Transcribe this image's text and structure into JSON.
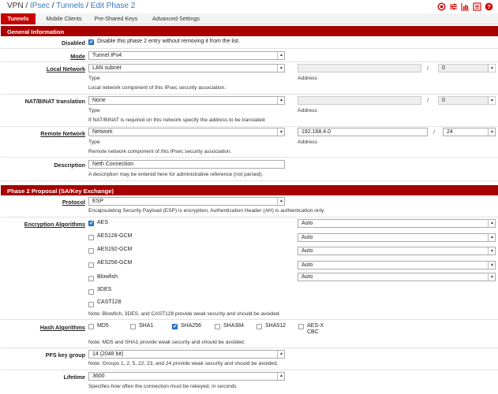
{
  "breadcrumb": {
    "vpn": "VPN",
    "ipsec": "IPsec",
    "tunnels": "Tunnels",
    "edit": "Edit Phase 2",
    "sep": "/"
  },
  "header_icons": [
    "stop-circle-icon",
    "sliders-icon",
    "bar-chart-icon",
    "list-icon",
    "help-icon"
  ],
  "tabs": [
    {
      "label": "Tunnels",
      "active": true
    },
    {
      "label": "Mobile Clients"
    },
    {
      "label": "Pre-Shared Keys"
    },
    {
      "label": "Advanced Settings"
    }
  ],
  "general": {
    "title": "General Information",
    "disabled": {
      "label": "Disabled",
      "text": "Disable this phase 2 entry without removing it from the list.",
      "checked": true
    },
    "mode": {
      "label": "Mode",
      "value": "Tunnel IPv4"
    },
    "local": {
      "label": "Local Network",
      "type_value": "LAN subnet",
      "type_caption": "Type",
      "address_value": "",
      "address_caption": "Address",
      "mask_value": "0",
      "help": "Local network component of this IPsec security association."
    },
    "nat": {
      "label": "NAT/BINAT translation",
      "type_value": "None",
      "type_caption": "Type",
      "address_value": "",
      "address_caption": "Address",
      "mask_value": "0",
      "help": "If NAT/BINAT is required on this network specify the address to be translated"
    },
    "remote": {
      "label": "Remote Network",
      "type_value": "Network",
      "type_caption": "Type",
      "address_value": "192.168.4.0",
      "address_caption": "Address",
      "mask_value": "24",
      "help": "Remote network component of this IPsec security association."
    },
    "description": {
      "label": "Description",
      "value": "Neth Connection",
      "help": "A description may be entered here for administrative reference (not parsed)."
    }
  },
  "phase2": {
    "title": "Phase 2 Proposal (SA/Key Exchange)",
    "protocol": {
      "label": "Protocol",
      "value": "ESP",
      "help": "Encapsulating Security Payload (ESP) is encryption, Authentication Header (AH) is authentication only."
    },
    "encryption": {
      "label": "Encryption Algorithms",
      "items": [
        {
          "name": "AES",
          "checked": true,
          "keylen": "Auto"
        },
        {
          "name": "AES128-GCM",
          "checked": false,
          "keylen": "Auto"
        },
        {
          "name": "AES192-GCM",
          "checked": false,
          "keylen": "Auto"
        },
        {
          "name": "AES256-GCM",
          "checked": false,
          "keylen": "Auto"
        },
        {
          "name": "Blowfish",
          "checked": false,
          "keylen": "Auto"
        },
        {
          "name": "3DES",
          "checked": false
        },
        {
          "name": "CAST128",
          "checked": false
        }
      ],
      "help": "Note: Blowfish, 3DES, and CAST128 provide weak security and should be avoided."
    },
    "hash": {
      "label": "Hash Algorithms",
      "items": [
        {
          "name": "MD5",
          "checked": false
        },
        {
          "name": "SHA1",
          "checked": false
        },
        {
          "name": "SHA256",
          "checked": true
        },
        {
          "name": "SHA384",
          "checked": false
        },
        {
          "name": "SHA512",
          "checked": false
        },
        {
          "name": "AES-XCBC",
          "checked": false
        }
      ],
      "help": "Note: MD5 and SHA1 provide weak security and should be avoided."
    },
    "pfs": {
      "label": "PFS key group",
      "value": "14 (2048 bit)",
      "help": "Note: Groups 1, 2, 5, 22, 23, and 24 provide weak security and should be avoided."
    },
    "lifetime": {
      "label": "Lifetime",
      "value": "3600",
      "help": "Specifies how often the connection must be rekeyed, in seconds"
    }
  }
}
